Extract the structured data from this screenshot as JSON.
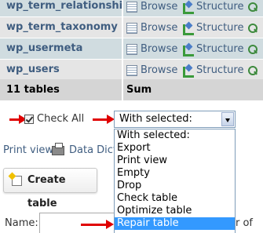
{
  "tables": [
    {
      "name": "wp_term_relationships",
      "browse": "Browse",
      "structure": "Structure"
    },
    {
      "name": "wp_term_taxonomy",
      "browse": "Browse",
      "structure": "Structure"
    },
    {
      "name": "wp_usermeta",
      "browse": "Browse",
      "structure": "Structure"
    },
    {
      "name": "wp_users",
      "browse": "Browse",
      "structure": "Structure"
    }
  ],
  "totals": {
    "count": "11 tables",
    "sum": "Sum"
  },
  "check_all": {
    "label": "Check All",
    "checked": true
  },
  "with_selected": {
    "value": "With selected:",
    "options": [
      "With selected:",
      "Export",
      "Print view",
      "Empty",
      "Drop",
      "Check table",
      "Optimize table",
      "Repair table"
    ],
    "highlighted": "Repair table"
  },
  "links": {
    "print_view": "Print view",
    "data_dictionary": "Data Dict"
  },
  "create_table": {
    "label": "Create table"
  },
  "name_field": {
    "label": "Name:",
    "value": "",
    "trailing": "r of"
  },
  "colors": {
    "row_odd": "#d0dce0",
    "row_even": "#e5e5e5",
    "link": "#3f5d80",
    "arrow": "#e00000",
    "highlight": "#3399ff"
  }
}
